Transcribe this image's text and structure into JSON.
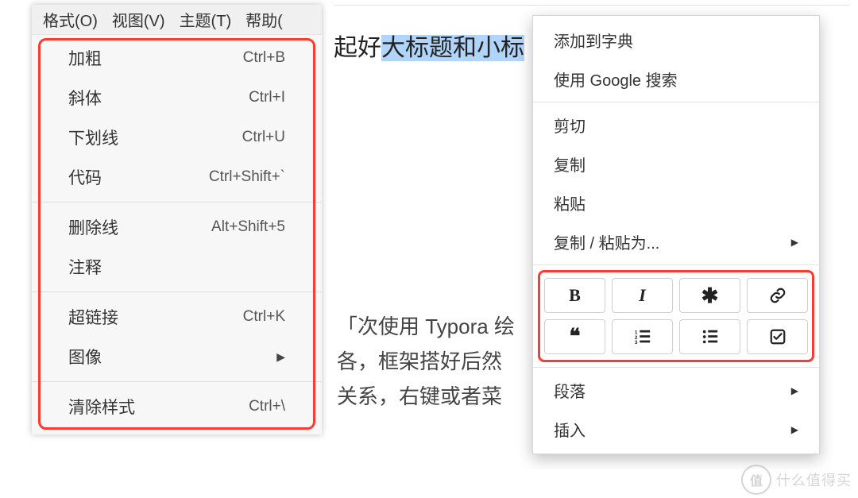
{
  "menubar": {
    "items": [
      "格式(O)",
      "视图(V)",
      "主题(T)",
      "帮助("
    ]
  },
  "dropdown": {
    "groups": [
      [
        {
          "label": "加粗",
          "shortcut": "Ctrl+B"
        },
        {
          "label": "斜体",
          "shortcut": "Ctrl+I"
        },
        {
          "label": "下划线",
          "shortcut": "Ctrl+U"
        },
        {
          "label": "代码",
          "shortcut": "Ctrl+Shift+`"
        }
      ],
      [
        {
          "label": "删除线",
          "shortcut": "Alt+Shift+5"
        },
        {
          "label": "注释",
          "shortcut": ""
        }
      ],
      [
        {
          "label": "超链接",
          "shortcut": "Ctrl+K"
        },
        {
          "label": "图像",
          "shortcut": "",
          "submenu": true
        }
      ],
      [
        {
          "label": "清除样式",
          "shortcut": "Ctrl+\\"
        }
      ]
    ]
  },
  "doc": {
    "heading_prefix": "起好",
    "heading_selected": "大标题和小标",
    "body1": "「次使用 Typora 绘",
    "body2": "各，框架搭好后然",
    "body3": "关系，右键或者菜"
  },
  "context_menu": {
    "sections": {
      "top": [
        {
          "label": "添加到字典"
        },
        {
          "label": "使用 Google 搜索"
        }
      ],
      "edit": [
        {
          "label": "剪切"
        },
        {
          "label": "复制"
        },
        {
          "label": "粘贴"
        },
        {
          "label": "复制 / 粘贴为...",
          "submenu": true
        }
      ],
      "bottom": [
        {
          "label": "段落",
          "submenu": true
        },
        {
          "label": "插入",
          "submenu": true
        }
      ]
    },
    "toolbar": [
      {
        "name": "bold-button",
        "icon": "bold"
      },
      {
        "name": "italic-button",
        "icon": "italic"
      },
      {
        "name": "asterisk-button",
        "icon": "asterisk"
      },
      {
        "name": "link-button",
        "icon": "link"
      },
      {
        "name": "quote-button",
        "icon": "quote"
      },
      {
        "name": "ordered-list-button",
        "icon": "ol"
      },
      {
        "name": "unordered-list-button",
        "icon": "ul"
      },
      {
        "name": "checkbox-button",
        "icon": "check"
      }
    ]
  },
  "watermark": {
    "logo": "值",
    "text": "什么值得买"
  }
}
